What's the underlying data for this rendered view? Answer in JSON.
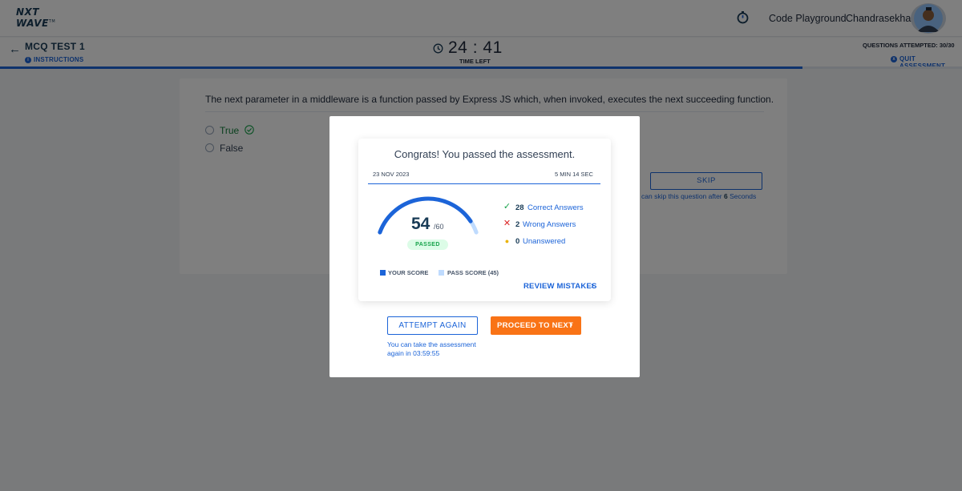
{
  "header": {
    "logo_line1": "NXT",
    "logo_line2": "WAVE",
    "logo_tm": "TM",
    "code_playground": "Code Playground",
    "user_name": "Chandrasekhar"
  },
  "subheader": {
    "test_title": "MCQ TEST 1",
    "instructions": "INSTRUCTIONS",
    "time_minutes": "24",
    "time_separator": ":",
    "time_seconds": "41",
    "time_left_label": "TIME LEFT",
    "questions_attempted": "QUESTIONS ATTEMPTED: 30/30",
    "quit": "QUIT ASSESSMENT",
    "progress_percent": 83.4
  },
  "question": {
    "text": "The next parameter in a middleware is a function passed by Express JS which, when invoked, executes the next succeeding function.",
    "options": [
      "True",
      "False"
    ],
    "correct_option": "True",
    "skip_label": "SKIP",
    "skip_note_prefix": "can skip this question after",
    "skip_seconds": "6",
    "skip_note_suffix": "Seconds"
  },
  "result": {
    "congrats": "Congrats! You passed the assessment.",
    "date": "23 NOV 2023",
    "duration": "5 MIN 14 SEC",
    "score": "54",
    "score_total": "/60",
    "score_value": 54,
    "score_max": 60,
    "status": "PASSED",
    "stats": [
      {
        "count": "28",
        "label": "Correct Answers",
        "icon": "check-icon",
        "color": "#16a34a"
      },
      {
        "count": "2",
        "label": "Wrong Answers",
        "icon": "cross-icon",
        "color": "#dc2626"
      },
      {
        "count": "0",
        "label": "Unanswered",
        "icon": "dot-icon",
        "color": "#eab308"
      }
    ],
    "legend_your_score": "YOUR SCORE",
    "legend_pass_score": "PASS SCORE (45)",
    "review": "REVIEW MISTAKES",
    "attempt_again": "ATTEMPT AGAIN",
    "proceed": "PROCEED TO NEXT",
    "retake_note": "You can take the assessment again in 03:59:55"
  },
  "colors": {
    "primary": "#1c64d8",
    "accent_orange": "#f97316",
    "success": "#16a34a",
    "pass_track": "#bfdbfe",
    "navy": "#183b56"
  }
}
